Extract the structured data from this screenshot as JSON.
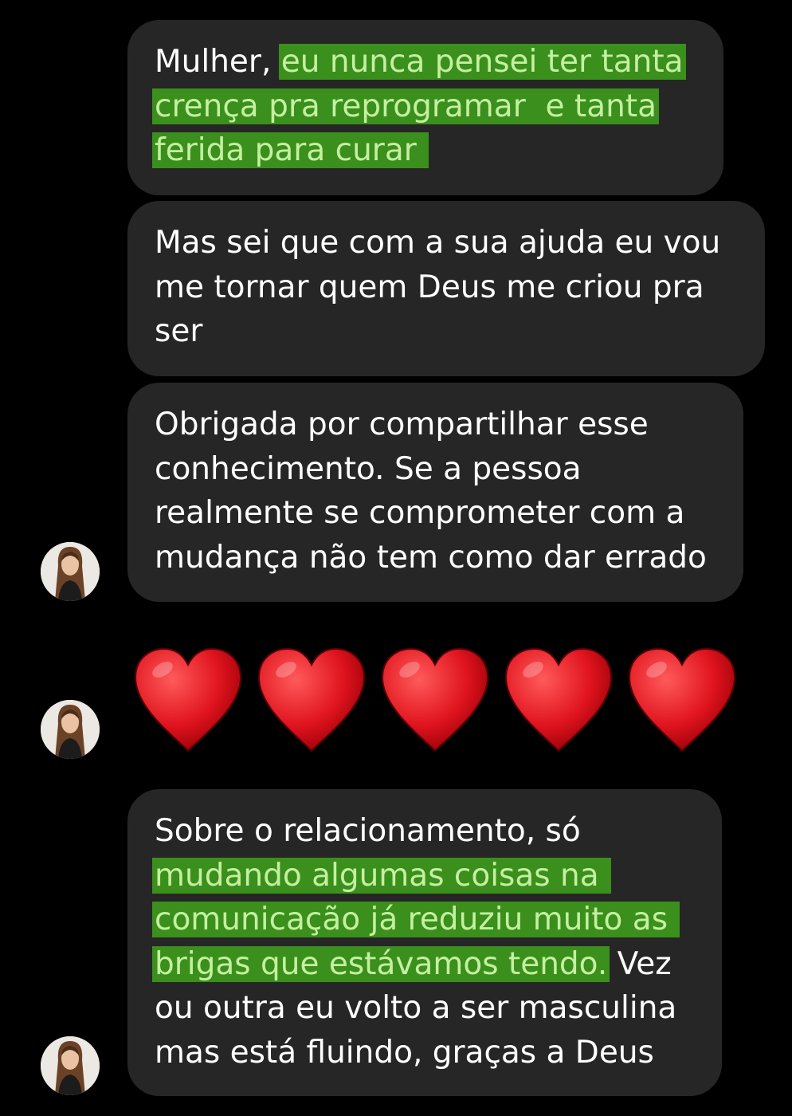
{
  "messages": [
    {
      "lines": [
        [
          {
            "t": "Mulher, ",
            "h": false
          },
          {
            "t": "eu nunca pensei ter tanta",
            "h": true
          }
        ],
        [
          {
            "t": "crença pra reprogramar  e tanta",
            "h": true
          }
        ],
        [
          {
            "t": "ferida para curar ",
            "h": true
          }
        ]
      ]
    },
    {
      "lines": [
        [
          {
            "t": "Mas sei que com a sua ajuda eu vou",
            "h": false
          }
        ],
        [
          {
            "t": "me tornar quem Deus me criou pra",
            "h": false
          }
        ],
        [
          {
            "t": "ser",
            "h": false
          }
        ]
      ]
    },
    {
      "lines": [
        [
          {
            "t": "Obrigada por compartilhar esse",
            "h": false
          }
        ],
        [
          {
            "t": "conhecimento. Se a pessoa",
            "h": false
          }
        ],
        [
          {
            "t": "realmente se comprometer com a",
            "h": false
          }
        ],
        [
          {
            "t": "mudança não tem como dar errado",
            "h": false
          }
        ]
      ]
    },
    {
      "emoji": "heart-icon",
      "count": 5
    },
    {
      "lines": [
        [
          {
            "t": "Sobre o relacionamento, só",
            "h": false
          }
        ],
        [
          {
            "t": "mudando algumas coisas na ",
            "h": true
          }
        ],
        [
          {
            "t": "comunicação já reduziu muito as ",
            "h": true
          }
        ],
        [
          {
            "t": "brigas que estávamos tendo.",
            "h": true
          },
          {
            "t": " Vez",
            "h": false
          }
        ],
        [
          {
            "t": "ou outra eu volto a ser masculina",
            "h": false
          }
        ],
        [
          {
            "t": "mas está fluindo, graças a Deus",
            "h": false
          }
        ]
      ]
    }
  ],
  "colors": {
    "background": "#000000",
    "bubble": "#262626",
    "text": "#ffffff",
    "highlight": "#3b8f1c",
    "highlight_text": "#c4f0a0",
    "heart": "#e0141e"
  },
  "avatars": [
    "avatar",
    "avatar",
    "avatar"
  ]
}
